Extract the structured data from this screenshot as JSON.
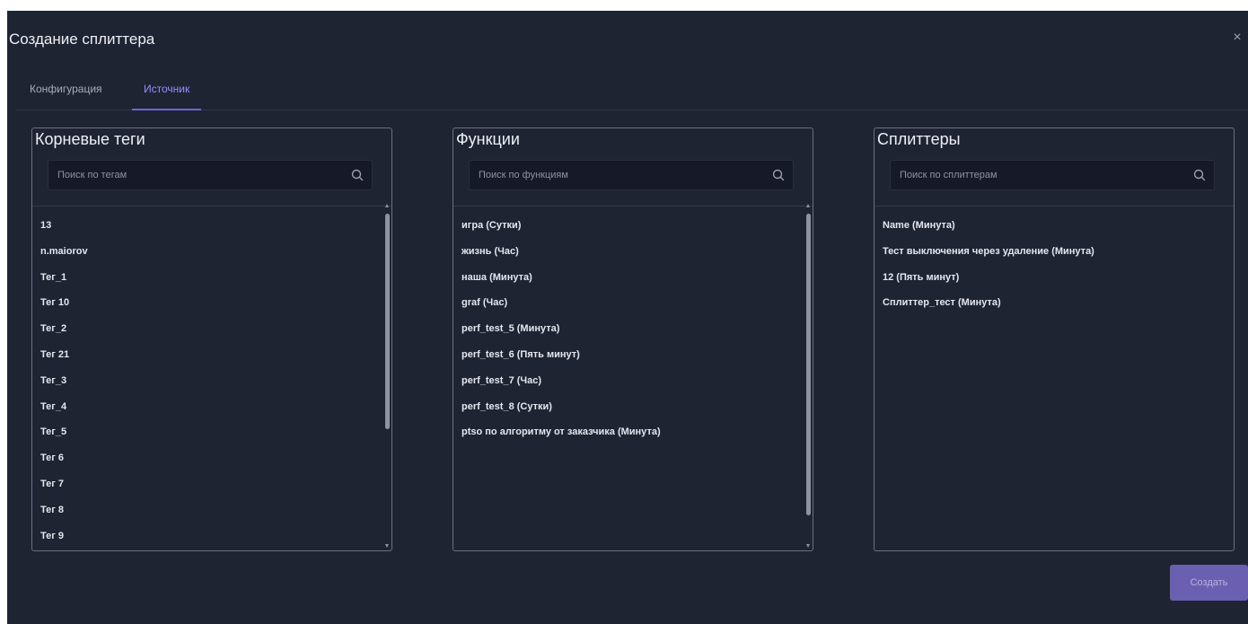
{
  "modal": {
    "title": "Создание сплиттера",
    "close_icon": "×"
  },
  "tabs": [
    {
      "label": "Конфигурация",
      "active": false
    },
    {
      "label": "Источник",
      "active": true
    }
  ],
  "panels": {
    "tags": {
      "title": "Корневые теги",
      "search_placeholder": "Поиск по тегам",
      "items": [
        "13",
        "n.maiorov",
        "Тег_1",
        "Тег 10",
        "Тег_2",
        "Тег 21",
        "Тег_3",
        "Тег_4",
        "Тег_5",
        "Тег 6",
        "Тег 7",
        "Тег 8",
        "Тег 9"
      ]
    },
    "functions": {
      "title": "Функции",
      "search_placeholder": "Поиск по функциям",
      "items": [
        "игра (Сутки)",
        "жизнь (Час)",
        "наша (Минута)",
        "graf (Час)",
        "perf_test_5 (Минута)",
        "perf_test_6 (Пять минут)",
        "perf_test_7 (Час)",
        "perf_test_8 (Сутки)",
        "ptso по алгоритму от заказчика (Минута)"
      ]
    },
    "splitters": {
      "title": "Сплиттеры",
      "search_placeholder": "Поиск по сплиттерам",
      "items": [
        "Name (Минута)",
        "Тест выключения через удаление (Минута)",
        "12 (Пять минут)",
        "Сплиттер_тест (Минута)"
      ]
    }
  },
  "footer": {
    "create_label": "Создать"
  },
  "icons": {
    "search": "search-icon",
    "close": "close-icon"
  },
  "colors": {
    "background": "#1f2433",
    "accent": "#6a5fb0",
    "active_tab": "#9a8cff"
  }
}
